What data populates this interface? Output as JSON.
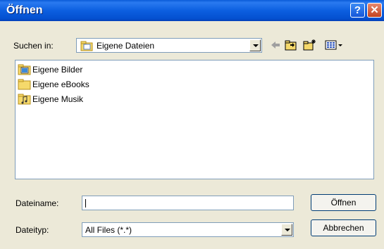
{
  "window": {
    "title": "Öffnen",
    "help_glyph": "?",
    "close_glyph": "✕"
  },
  "lookin": {
    "label": "Suchen in:",
    "value": "Eigene Dateien"
  },
  "toolbar": {
    "back_icon": "back-arrow-icon",
    "up_icon": "up-one-level-icon",
    "newfolder_icon": "new-folder-icon",
    "views_icon": "view-menu-icon"
  },
  "files": [
    {
      "label": "Eigene Bilder",
      "icon": "pictures-folder-icon"
    },
    {
      "label": "Eigene eBooks",
      "icon": "folder-icon"
    },
    {
      "label": "Eigene Musik",
      "icon": "music-folder-icon"
    }
  ],
  "filename": {
    "label": "Dateiname:",
    "value": ""
  },
  "filetype": {
    "label": "Dateityp:",
    "value": "All Files (*.*)"
  },
  "buttons": {
    "open": "Öffnen",
    "cancel": "Abbrechen"
  }
}
